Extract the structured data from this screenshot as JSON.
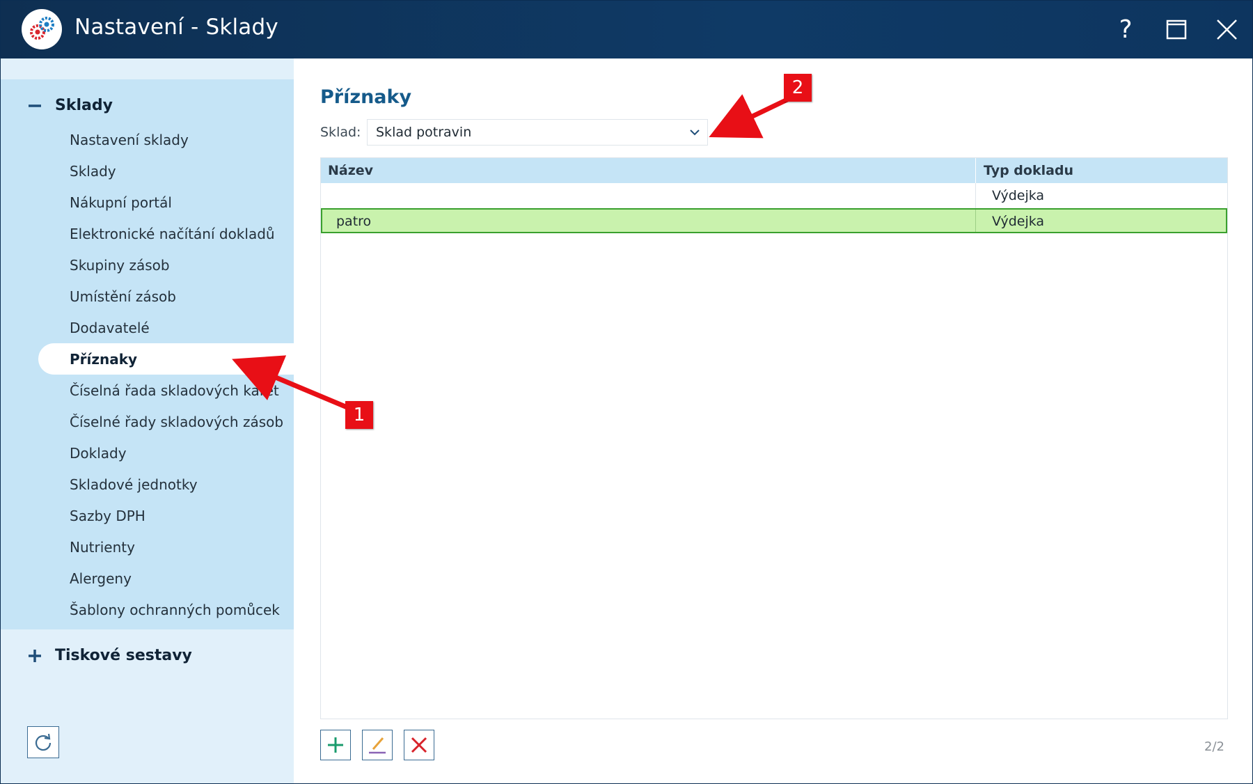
{
  "window": {
    "title": "Nastavení - Sklady",
    "help_label": "?",
    "icons": {
      "logo": "gears-logo-icon",
      "maximize": "maximize-icon",
      "close": "close-icon"
    }
  },
  "sidebar": {
    "groups": [
      {
        "label": "Sklady",
        "expanded": true,
        "sign_icon": "minus-icon",
        "items": [
          {
            "label": "Nastavení sklady"
          },
          {
            "label": "Sklady"
          },
          {
            "label": "Nákupní portál"
          },
          {
            "label": "Elektronické načítání dokladů"
          },
          {
            "label": "Skupiny zásob"
          },
          {
            "label": "Umístění zásob"
          },
          {
            "label": "Dodavatelé"
          },
          {
            "label": "Příznaky",
            "active": true
          },
          {
            "label": "Číselná řada skladových karet"
          },
          {
            "label": "Číselné řady skladových zásob"
          },
          {
            "label": "Doklady"
          },
          {
            "label": "Skladové jednotky"
          },
          {
            "label": "Sazby DPH"
          },
          {
            "label": "Nutrienty"
          },
          {
            "label": "Alergeny"
          },
          {
            "label": "Šablony ochranných pomůcek"
          }
        ]
      },
      {
        "label": "Tiskové sestavy",
        "expanded": false,
        "sign_icon": "plus-icon"
      }
    ],
    "refresh_icon": "refresh-icon"
  },
  "main": {
    "title": "Příznaky",
    "sklad_label": "Sklad:",
    "sklad_value": "Sklad potravin",
    "grid": {
      "columns": [
        "Název",
        "Typ dokladu"
      ],
      "rows": [
        {
          "nazev": "",
          "typ": "Výdejka"
        },
        {
          "nazev": "patro",
          "typ": "Výdejka",
          "selected": true
        }
      ]
    },
    "toolbar": {
      "add_icon": "plus-icon",
      "edit_icon": "pencil-icon",
      "delete_icon": "delete-x-icon"
    },
    "record_count": "2/2"
  },
  "annotations": [
    {
      "number": "1"
    },
    {
      "number": "2"
    }
  ],
  "colors": {
    "titlebar": "#0f3a66",
    "sidebar_bg": "#e1f0fa",
    "sidebar_group_bg": "#c5e4f6",
    "grid_header": "#c5e4f6",
    "selected_row": "#c9f2ad",
    "selected_border": "#3aa02e",
    "title_blue": "#155a8a",
    "callout_red": "#e80f16"
  }
}
